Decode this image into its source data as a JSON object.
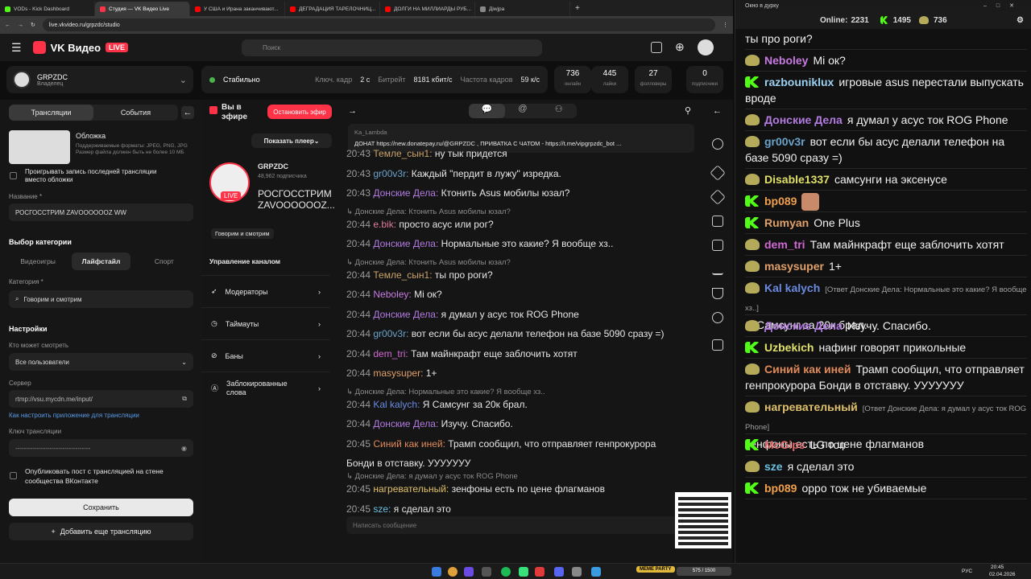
{
  "browser": {
    "tabs": [
      {
        "label": "VODs - Kick Dashboard",
        "color": "#53fc18"
      },
      {
        "label": "Студия — VK Видео Live",
        "color": "#ff3347"
      },
      {
        "label": "У США и Ирана заканчивают...",
        "color": "#ff0000"
      },
      {
        "label": "ДЕГРАДАЦИЯ ТАРЕЛОЧНИЦ...",
        "color": "#ff0000"
      },
      {
        "label": "ДОЛГИ НА МИЛЛИАРДЫ РУБ...",
        "color": "#ff0000"
      },
      {
        "label": "Дiwjра",
        "color": "#888888"
      }
    ],
    "url": "live.vkvideo.ru/grpzdc/studio"
  },
  "header": {
    "logo": "VK Видео",
    "live": "LIVE",
    "search_placeholder": "Поиск"
  },
  "channel": {
    "name": "GRPZDC",
    "role": "Владелец"
  },
  "stream_status": {
    "status": "Стабильно",
    "keyframe_label": "Ключ. кадр",
    "keyframe": "2 с",
    "bitrate_label": "Битрейт",
    "bitrate": "8181 кбит/с",
    "fps_label": "Частота кадров",
    "fps": "59 к/с"
  },
  "stats": [
    {
      "value": "736",
      "label": "онлайн"
    },
    {
      "value": "445",
      "label": "лайки"
    },
    {
      "value": "27",
      "label": "фолловеры"
    },
    {
      "value": "0",
      "label": "подписчики"
    }
  ],
  "left": {
    "tab_streams": "Трансляции",
    "tab_events": "События",
    "cover_title": "Обложка",
    "cover_desc": "Поддерживаемые форматы: JPEG, PNG, JPG Размер файла должен быть не более 10 МБ",
    "replay_label": "Проигрывать запись последней трансляции вместо обложки",
    "name_label": "Название *",
    "name_value": "РОСГОССТРИМ ZAVOOOOOOZ WW",
    "category_section": "Выбор категории",
    "cat_games": "Видеоигры",
    "cat_lifestyle": "Лайфстайл",
    "cat_sport": "Спорт",
    "category_label": "Категория *",
    "category_value": "Говорим и смотрим",
    "settings": "Настройки",
    "who_label": "Кто может смотреть",
    "who_value": "Все пользователи",
    "server_label": "Сервер",
    "server_value": "rtmp://vsu.mycdn.me/input/",
    "howto": "Как настроить приложение для трансляции",
    "key_label": "Ключ трансляции",
    "key_value": "-----------------------------------",
    "publish_label": "Опубликовать пост с трансляцией на стене сообщества ВКонтакте",
    "save": "Сохранить",
    "add": "Добавить еще трансляцию"
  },
  "mid": {
    "on_air": "Вы в эфире",
    "stop": "Остановить эфир",
    "show_player": "Показать плеер",
    "channel": "GRPZDC",
    "subs": "48,962 подписчика",
    "title": "РОСГОССТРИМ ZAVOOOOOOZ...",
    "live": "LIVE",
    "category": "Говорим и смотрим",
    "manage": "Управление каналом",
    "menu": [
      "Модераторы",
      "Таймауты",
      "Баны",
      "Заблокированные слова"
    ]
  },
  "chat": {
    "pinned_user": "Ka_Lambda",
    "pinned_text": "ДОНАТ https://new.donatepay.ru/@GRPZDC , ПРИВАТКА С ЧАТОМ - https://t.me/vipgrpzdc_bot ...",
    "input_placeholder": "Написать сообщение",
    "messages": [
      {
        "time": "20:43",
        "user": "Темле_сын1:",
        "color": "#c9a36a",
        "text": "ну тык придется"
      },
      {
        "time": "20:43",
        "user": "gr00v3r:",
        "color": "#6aa3c9",
        "text": "Каждый \"пердит в лужу\" изредка."
      },
      {
        "time": "20:43",
        "user": "Донские Дела:",
        "color": "#b27be0",
        "text": "Ктонить Asus мобилы юзал?"
      },
      {
        "reply": "Донские Дела: Ктонить Asus мобилы юзал?"
      },
      {
        "time": "20:44",
        "user": "e.bik:",
        "color": "#e07b9a",
        "text": "просто асус или рог?"
      },
      {
        "time": "20:44",
        "user": "Донские Дела:",
        "color": "#b27be0",
        "text": "Нормальные это какие? Я вообще хз.."
      },
      {
        "reply": "Донские Дела: Ктонить Asus мобилы юзал?"
      },
      {
        "time": "20:44",
        "user": "Темле_сын1:",
        "color": "#c9a36a",
        "text": "ты про роги?"
      },
      {
        "time": "20:44",
        "user": "Neboley:",
        "color": "#c77be0",
        "text": "Mi ок?"
      },
      {
        "time": "20:44",
        "user": "Донские Дела:",
        "color": "#b27be0",
        "text": "я думал у асус ток ROG Phone"
      },
      {
        "time": "20:44",
        "user": "gr00v3r:",
        "color": "#6aa3c9",
        "text": "вот если бы асус делали телефон на базе 5090 сразу =)"
      },
      {
        "time": "20:44",
        "user": "dem_tri:",
        "color": "#d06ad0",
        "text": "Там майнкрафт еще заблочить хотят"
      },
      {
        "time": "20:44",
        "user": "masysuper:",
        "color": "#e0a06a",
        "text": "1+"
      },
      {
        "reply": "Донские Дела: Нормальные это какие? Я вообще хз.."
      },
      {
        "time": "20:44",
        "user": "Kal kalych:",
        "color": "#6a8ae0",
        "text": "Я Самсунг за 20к брал."
      },
      {
        "time": "20:44",
        "user": "Донские Дела:",
        "color": "#b27be0",
        "text": "Изучу. Спасибо."
      },
      {
        "time": "20:45",
        "user": "Синий как иней:",
        "color": "#e08a5a",
        "text": "Трамп сообщил, что отправляет генпрокурора"
      },
      {
        "cont": "Бонди в отставку. УУУУУУУ"
      },
      {
        "reply": "Донские Дела: я думал у асус ток ROG Phone"
      },
      {
        "time": "20:45",
        "user": "нагревательный:",
        "color": "#e0c06a",
        "text": "зенфоны есть по цене флагманов"
      },
      {
        "time": "20:45",
        "user": "sze:",
        "color": "#6ac0e0",
        "text": "я сделал это"
      }
    ]
  },
  "overlay": {
    "window_title": "Окно в дурку",
    "online_label": "Online:",
    "online": "2231",
    "kick_count": "1495",
    "vk_count": "736",
    "messages": [
      {
        "badge": "",
        "user": "",
        "color": "#ffffff",
        "text": "ты про роги?"
      },
      {
        "badge": "p",
        "user": "Neboley",
        "color": "#c77be0",
        "text": "Mi ок?"
      },
      {
        "badge": "k",
        "user": "razbouniklux",
        "color": "#9ad0f0",
        "text": "игровые asus перестали выпускать вроде"
      },
      {
        "badge": "p",
        "user": "Донские Дела",
        "color": "#b27be0",
        "text": "я думал у асус ток ROG Phone"
      },
      {
        "badge": "p",
        "user": "gr00v3r",
        "color": "#6aa3c9",
        "text": "вот если бы асус делали телефон на базе 5090 сразу =)"
      },
      {
        "badge": "p",
        "user": "Disable1337",
        "color": "#e0e06a",
        "text": "самсунги на эксенусе"
      },
      {
        "badge": "k",
        "user": "bp089",
        "color": "#f0a04a",
        "text": ""
      },
      {
        "badge": "k",
        "user": "Rumyan",
        "color": "#e0a06a",
        "text": "One Plus"
      },
      {
        "badge": "p",
        "user": "dem_tri",
        "color": "#d06ad0",
        "text": "Там майнкрафт еще заблочить хотят"
      },
      {
        "badge": "p",
        "user": "masysuper",
        "color": "#e0a06a",
        "text": "1+"
      },
      {
        "badge": "p",
        "user": "Kal kalych",
        "color": "#6a8ae0",
        "reply": "[Ответ Донские Дела: Нормальные это какие? Я вообще хз..]",
        "text": "Я Самсунг за 20к брал."
      },
      {
        "badge": "p",
        "user": "Донские Дела",
        "color": "#b27be0",
        "text": "Изучу. Спасибо."
      },
      {
        "badge": "k",
        "user": "Uzbekich",
        "color": "#e0e06a",
        "text": "нафинг говорят прикольные"
      },
      {
        "badge": "p",
        "user": "Синий как иней",
        "color": "#e08a5a",
        "text": "Трамп сообщил, что отправляет генпрокурора Бонди в отставку. УУУУУУУ"
      },
      {
        "badge": "p",
        "user": "нагревательный",
        "color": "#e0c06a",
        "reply": "[Ответ Донские Дела: я думал у асус ток ROG Phone]",
        "text": "зенфоны есть по цене флагманов"
      },
      {
        "badge": "k",
        "user": "McGips",
        "color": "#e06a6a",
        "text": "LG топ"
      },
      {
        "badge": "p",
        "user": "sze",
        "color": "#6ac0e0",
        "text": "я сделал это"
      },
      {
        "badge": "k",
        "user": "bp089",
        "color": "#f0a04a",
        "text": "oppo тож не убиваемые"
      }
    ]
  },
  "taskbar": {
    "lang": "РУС",
    "time": "20:45",
    "date": "02.04.2026",
    "meme": "MEME PARTY",
    "meter": "575 / 1500"
  }
}
